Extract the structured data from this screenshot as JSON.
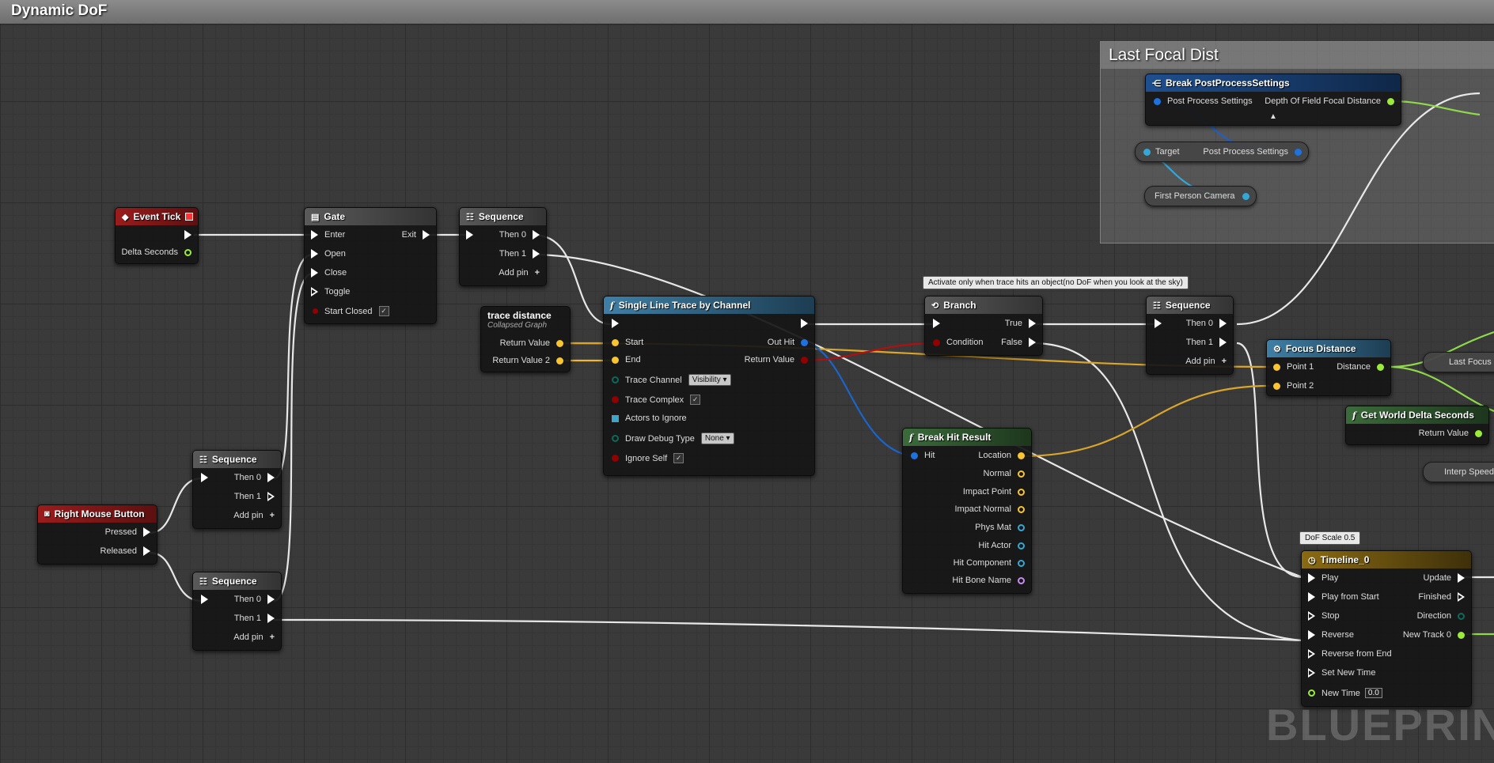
{
  "window_title": "Dynamic DoF",
  "watermark": "BLUEPRINT",
  "colors": {
    "exec": "#ffffff",
    "float": "#9bec39",
    "vector": "#f8c530",
    "bool": "#930000",
    "struct": "#0059cb",
    "object": "#35a7d6",
    "comment_bg": "#c8c8c8",
    "event_header": "#8a1a1a",
    "function_header": "#3a6f8e",
    "pure_function_header": "#3b6b3b",
    "macro_header": "#4a4a4a",
    "timeline_header": "#7d6116"
  },
  "comment": {
    "title": "Last Focal Dist"
  },
  "nodes": {
    "event_tick": {
      "title": "Event Tick",
      "icon": "event-icon",
      "out_delta": "Delta Seconds"
    },
    "gate": {
      "title": "Gate",
      "enter": "Enter",
      "open": "Open",
      "close": "Close",
      "toggle": "Toggle",
      "start_closed": "Start Closed",
      "exit": "Exit"
    },
    "seq_top": {
      "title": "Sequence",
      "then0": "Then 0",
      "then1": "Then 1",
      "add_pin": "Add pin"
    },
    "trace_distance": {
      "title": "trace distance",
      "subtitle": "Collapsed Graph",
      "out1": "Return Value",
      "out2": "Return Value 2"
    },
    "line_trace": {
      "title": "Single Line Trace by Channel",
      "start": "Start",
      "end": "End",
      "trace_channel": "Trace Channel",
      "trace_channel_value": "Visibility",
      "trace_complex": "Trace Complex",
      "actors_to_ignore": "Actors to Ignore",
      "draw_debug_type": "Draw Debug Type",
      "draw_debug_value": "None",
      "ignore_self": "Ignore Self",
      "out_hit": "Out Hit",
      "return_value": "Return Value"
    },
    "branch": {
      "title": "Branch",
      "condition": "Condition",
      "true": "True",
      "false": "False",
      "comment": "Activate only when trace hits an object(no DoF when you look at the sky)"
    },
    "break_hit": {
      "title": "Break Hit Result",
      "hit": "Hit",
      "outputs": [
        "Location",
        "Normal",
        "Impact Point",
        "Impact Normal",
        "Phys Mat",
        "Hit Actor",
        "Hit Component",
        "Hit Bone Name"
      ]
    },
    "seq_right": {
      "title": "Sequence",
      "then0": "Then 0",
      "then1": "Then 1",
      "add_pin": "Add pin"
    },
    "focus_distance": {
      "title": "Focus Distance",
      "point1": "Point 1",
      "point2": "Point 2",
      "distance": "Distance"
    },
    "last_focus": {
      "label": "Last Focus"
    },
    "get_world_delta": {
      "title": "Get World Delta Seconds",
      "return_value": "Return Value"
    },
    "interp_speed": {
      "label": "Interp Speed"
    },
    "right_mouse": {
      "title": "Right Mouse Button",
      "pressed": "Pressed",
      "released": "Released"
    },
    "seq_mid": {
      "title": "Sequence",
      "then0": "Then 0",
      "then1": "Then 1",
      "add_pin": "Add pin"
    },
    "seq_bottom": {
      "title": "Sequence",
      "then0": "Then 0",
      "then1": "Then 1",
      "add_pin": "Add pin"
    },
    "timeline": {
      "title": "Timeline_0",
      "comment": "DoF Scale 0.5",
      "inputs": [
        "Play",
        "Play from Start",
        "Stop",
        "Reverse",
        "Reverse from End",
        "Set New Time",
        "New Time"
      ],
      "new_time_value": "0.0",
      "update": "Update",
      "finished": "Finished",
      "direction": "Direction",
      "new_track": "New Track 0"
    },
    "break_pp": {
      "title": "Break PostProcessSettings",
      "in": "Post Process Settings",
      "out": "Depth Of Field Focal Distance"
    },
    "target_pp": {
      "target": "Target",
      "out": "Post Process Settings"
    },
    "first_person_camera": {
      "label": "First Person Camera"
    }
  }
}
